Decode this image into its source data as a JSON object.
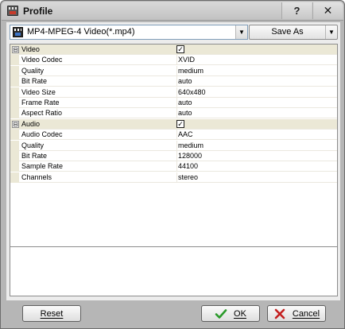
{
  "window": {
    "title": "Profile",
    "help_label": "?",
    "close_label": "✕"
  },
  "format": {
    "selected": "MP4-MPEG-4 Video(*.mp4)",
    "icon": "video-format-icon"
  },
  "save_as": {
    "label": "Save As"
  },
  "properties": [
    {
      "kind": "category",
      "name": "Video",
      "checked": true,
      "expander": "⊟"
    },
    {
      "kind": "property",
      "name": "Video Codec",
      "value": "XVID"
    },
    {
      "kind": "property",
      "name": "Quality",
      "value": "medium"
    },
    {
      "kind": "property",
      "name": "Bit Rate",
      "value": "auto"
    },
    {
      "kind": "property",
      "name": "Video Size",
      "value": "640x480"
    },
    {
      "kind": "property",
      "name": "Frame Rate",
      "value": "auto"
    },
    {
      "kind": "property",
      "name": "Aspect Ratio",
      "value": "auto"
    },
    {
      "kind": "category",
      "name": "Audio",
      "checked": true,
      "expander": "⊟"
    },
    {
      "kind": "property",
      "name": "Audio Codec",
      "value": "AAC"
    },
    {
      "kind": "property",
      "name": "Quality",
      "value": "medium"
    },
    {
      "kind": "property",
      "name": "Bit Rate",
      "value": "128000"
    },
    {
      "kind": "property",
      "name": "Sample Rate",
      "value": "44100"
    },
    {
      "kind": "property",
      "name": "Channels",
      "value": "stereo"
    }
  ],
  "buttons": {
    "reset": "Reset",
    "ok": "OK",
    "cancel": "Cancel"
  },
  "colors": {
    "ok_check": "#2a9a2a",
    "cancel_x": "#c42020",
    "category_bg": "#ebe8d6"
  }
}
